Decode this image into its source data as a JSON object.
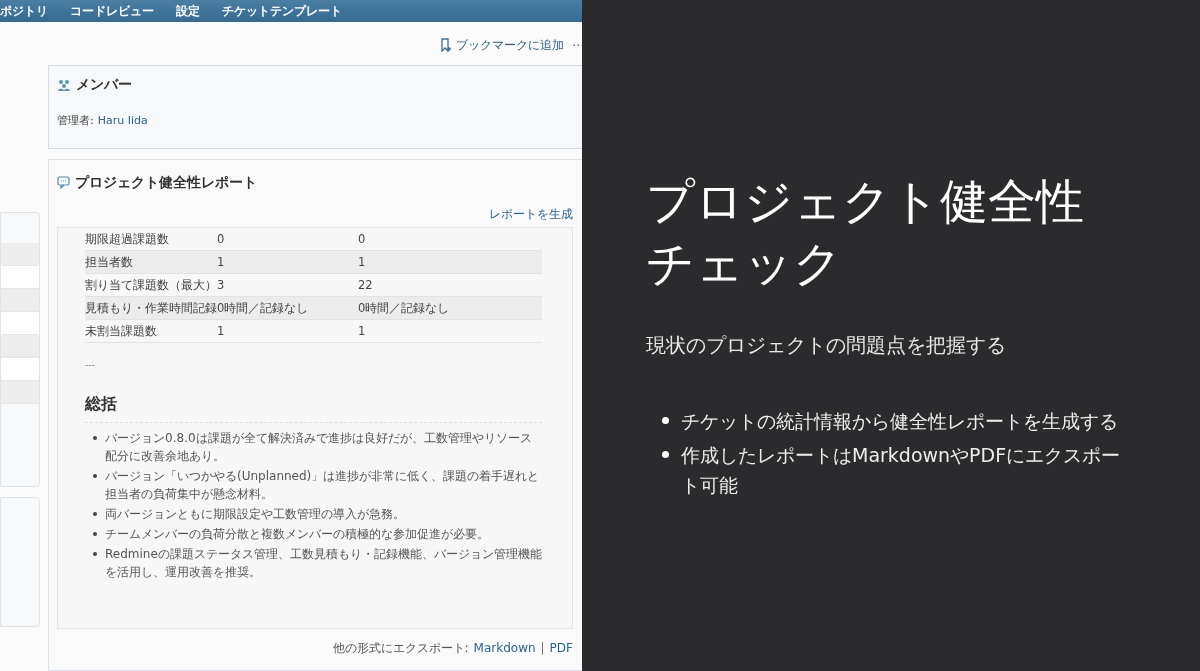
{
  "nav": [
    "ポジトリ",
    "コードレビュー",
    "設定",
    "チケットテンプレート"
  ],
  "toolbar": {
    "bookmark": "ブックマークに追加",
    "more": "⋯"
  },
  "members": {
    "title": "メンバー",
    "manager_label": "管理者:",
    "manager": "Haru Iida"
  },
  "report": {
    "title": "プロジェクト健全性レポート",
    "generate": "レポートを生成",
    "table": {
      "rows": [
        [
          "期限超過課題数",
          "0",
          "0"
        ],
        [
          "担当者数",
          "1",
          "1"
        ],
        [
          "割り当て課題数（最大）",
          "3",
          "22"
        ],
        [
          "見積もり・作業時間記録",
          "0時間／記録なし",
          "0時間／記録なし"
        ],
        [
          "未割当課題数",
          "1",
          "1"
        ]
      ]
    },
    "separator": "---",
    "summary_title": "総括",
    "summary": [
      "バージョン0.8.0は課題が全て解決済みで進捗は良好だが、工数管理やリソース配分に改善余地あり。",
      "バージョン「いつかやる(Unplanned)」は進捗が非常に低く、課題の着手遅れと担当者の負荷集中が懸念材料。",
      "両バージョンともに期限設定や工数管理の導入が急務。",
      "チームメンバーの負荷分散と複数メンバーの積極的な参加促進が必要。",
      "Redmineの課題ステータス管理、工数見積もり・記録機能、バージョン管理機能を活用し、運用改善を推奨。"
    ],
    "export_label": "他の形式にエクスポート:",
    "export_links": [
      "Markdown",
      "PDF"
    ],
    "export_separator": "|"
  },
  "slide": {
    "title": "プロジェクト健全性チェック",
    "subtitle": "現状のプロジェクトの問題点を把握する",
    "bullets": [
      "チケットの統計情報から健全性レポートを生成する",
      "作成したレポートはMarkdownやPDFにエクスポート可能"
    ]
  }
}
